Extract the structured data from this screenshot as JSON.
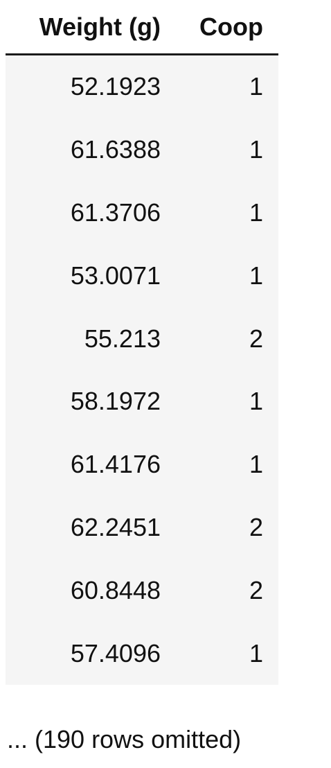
{
  "table": {
    "columns": [
      "Weight (g)",
      "Coop"
    ],
    "rows": [
      [
        "52.1923",
        "1"
      ],
      [
        "61.6388",
        "1"
      ],
      [
        "61.3706",
        "1"
      ],
      [
        "53.0071",
        "1"
      ],
      [
        "55.213",
        "2"
      ],
      [
        "58.1972",
        "1"
      ],
      [
        "61.4176",
        "1"
      ],
      [
        "62.2451",
        "2"
      ],
      [
        "60.8448",
        "2"
      ],
      [
        "57.4096",
        "1"
      ]
    ]
  },
  "footer": {
    "text": "... (190 rows omitted)"
  }
}
